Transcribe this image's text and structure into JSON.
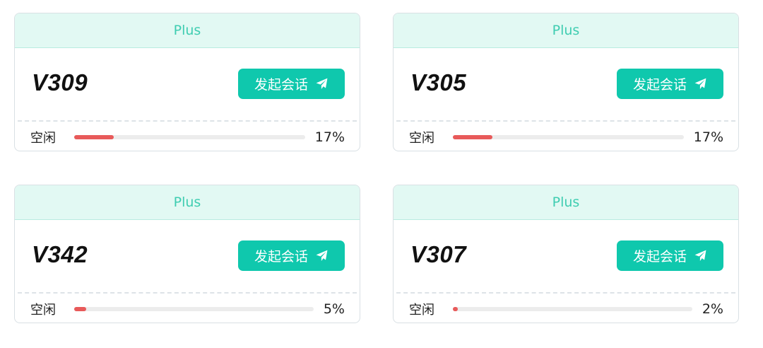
{
  "cards": [
    {
      "tier": "Plus",
      "name": "V309",
      "button_label": "发起会话",
      "status": "空闲",
      "usage_percent": 17,
      "usage_text": "17%",
      "usage_fraction": 0.17
    },
    {
      "tier": "Plus",
      "name": "V305",
      "button_label": "发起会话",
      "status": "空闲",
      "usage_percent": 17,
      "usage_text": "17%",
      "usage_fraction": 0.17
    },
    {
      "tier": "Plus",
      "name": "V342",
      "button_label": "发起会话",
      "status": "空闲",
      "usage_percent": 5,
      "usage_text": "5%",
      "usage_fraction": 0.05
    },
    {
      "tier": "Plus",
      "name": "V307",
      "button_label": "发起会话",
      "status": "空闲",
      "usage_percent": 2,
      "usage_text": "2%",
      "usage_fraction": 0.02
    }
  ],
  "colors": {
    "accent": "#0fc8ad",
    "header_bg": "#e2f9f3",
    "header_text": "#3fcdb1",
    "progress_fill": "#e85a5a",
    "progress_track": "#ececec"
  },
  "icons": {
    "button_icon": "paper-plane-icon"
  }
}
